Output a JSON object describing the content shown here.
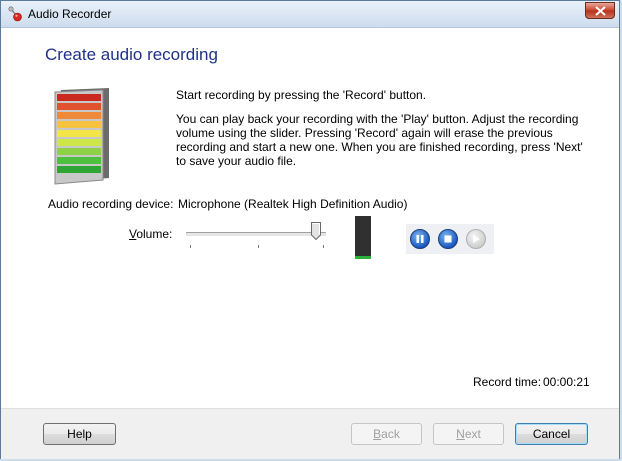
{
  "window": {
    "title": "Audio Recorder"
  },
  "page": {
    "heading": "Create audio recording",
    "intro": "Start recording by pressing the 'Record' button.",
    "instructions": "You can play back your recording with the 'Play' button. Adjust the recording volume using the slider.  Pressing 'Record' again will erase the previous recording and start a new one.  When you are finished recording, press 'Next' to save your audio file."
  },
  "device": {
    "label": "Audio recording device:",
    "value": "Microphone (Realtek High Definition Audio)"
  },
  "volume": {
    "label_mnemonic": "V",
    "label_rest": "olume:",
    "level_fraction": 0.93
  },
  "level_meter": {
    "level_fraction": 0.07,
    "color": "#2bb23a"
  },
  "transport": {
    "pause_icon": "pause-icon",
    "stop_icon": "stop-icon",
    "play_icon": "play-icon"
  },
  "record_time": {
    "label": "Record time:",
    "value": "00:00:21"
  },
  "footer": {
    "help": "Help",
    "back_mnemonic": "B",
    "back_rest": "ack",
    "next_mnemonic": "N",
    "next_rest": "ext",
    "cancel": "Cancel"
  },
  "colors": {
    "heading": "#1e3287",
    "accent": "#1a58c0"
  }
}
